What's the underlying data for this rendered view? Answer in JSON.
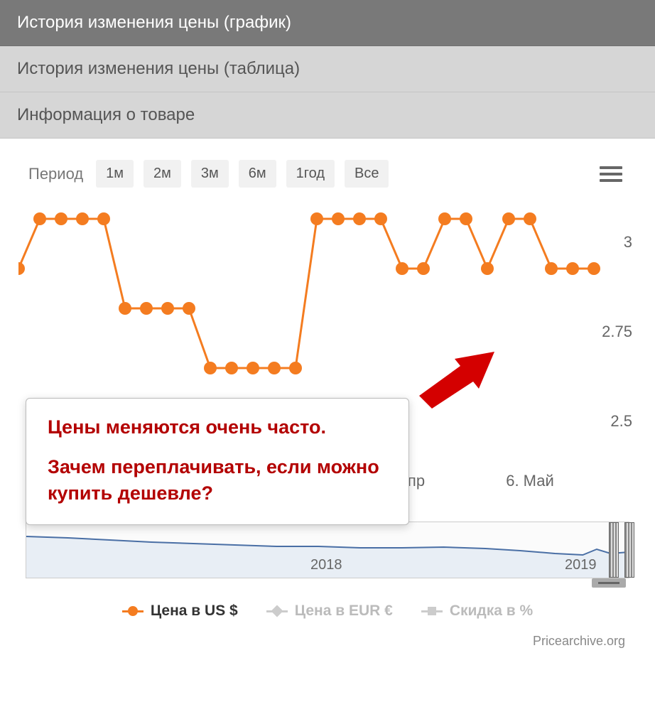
{
  "tabs": {
    "chart": "История изменения цены (график)",
    "table": "История изменения цены (таблица)",
    "info": "Информация о товаре"
  },
  "toolbar": {
    "period_label": "Период",
    "buttons": [
      "1м",
      "2м",
      "3м",
      "6м",
      "1год",
      "Все"
    ]
  },
  "chart_data": {
    "type": "line",
    "ylabel": "",
    "xlabel": "",
    "ylim": [
      2.4,
      3.15
    ],
    "yticks": [
      2.5,
      2.75,
      3
    ],
    "xticks": [
      "пр",
      "6. Май"
    ],
    "x": [
      0,
      1,
      2,
      3,
      4,
      5,
      6,
      7,
      8,
      9,
      10,
      11,
      12,
      13,
      14,
      15,
      16,
      17,
      18,
      19,
      20,
      21,
      22,
      23,
      24,
      25,
      26,
      27
    ],
    "values": [
      2.97,
      3.12,
      3.12,
      3.12,
      3.12,
      2.85,
      2.85,
      2.85,
      2.85,
      2.67,
      2.67,
      2.67,
      2.67,
      2.67,
      3.12,
      3.12,
      3.12,
      3.12,
      2.97,
      2.97,
      3.12,
      3.12,
      2.97,
      3.12,
      3.12,
      2.97,
      2.97,
      2.97
    ],
    "nav_years": [
      "2018",
      "2019"
    ]
  },
  "callout": {
    "line1": "Цены меняются очень часто.",
    "line2": "Зачем переплачивать, если можно купить дешевле?"
  },
  "legend": {
    "usd": "Цена в US $",
    "eur": "Цена в EUR €",
    "discount": "Скидка в %"
  },
  "footer": "Pricearchive.org",
  "colors": {
    "accent": "#f47c20",
    "arrow": "#d40000",
    "nav_line": "#4a6fa5"
  }
}
